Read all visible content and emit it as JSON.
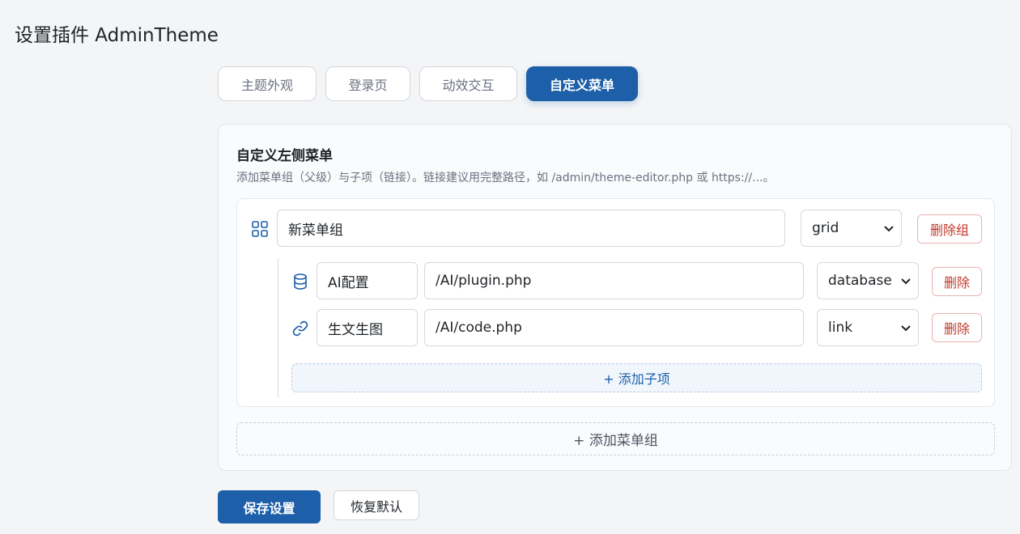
{
  "header": {
    "title": "设置插件 AdminTheme"
  },
  "tabs": [
    {
      "label": "主题外观"
    },
    {
      "label": "登录页"
    },
    {
      "label": "动效交互"
    },
    {
      "label": "自定义菜单",
      "active": true
    }
  ],
  "menu_card": {
    "title": "自定义左侧菜单",
    "description": "添加菜单组（父级）与子项（链接）。链接建议用完整路径，如 /admin/theme-editor.php 或 https://...。",
    "groups": [
      {
        "icon": "grid-icon",
        "name": "新菜单组",
        "icon_select": "grid",
        "delete_label": "删除组",
        "items": [
          {
            "icon": "database-icon",
            "name": "AI配置",
            "url": "/AI/plugin.php",
            "icon_select": "database",
            "delete_label": "删除"
          },
          {
            "icon": "link-icon",
            "name": "生文生图",
            "url": "/AI/code.php",
            "icon_select": "link",
            "delete_label": "删除"
          }
        ],
        "add_child_label": "+ 添加子项"
      }
    ],
    "add_group_label": "+ 添加菜单组"
  },
  "footer": {
    "save_label": "保存设置",
    "reset_label": "恢复默认"
  },
  "colors": {
    "primary": "#1d5fa8",
    "danger": "#c0392b",
    "background": "#f4f5f7"
  }
}
